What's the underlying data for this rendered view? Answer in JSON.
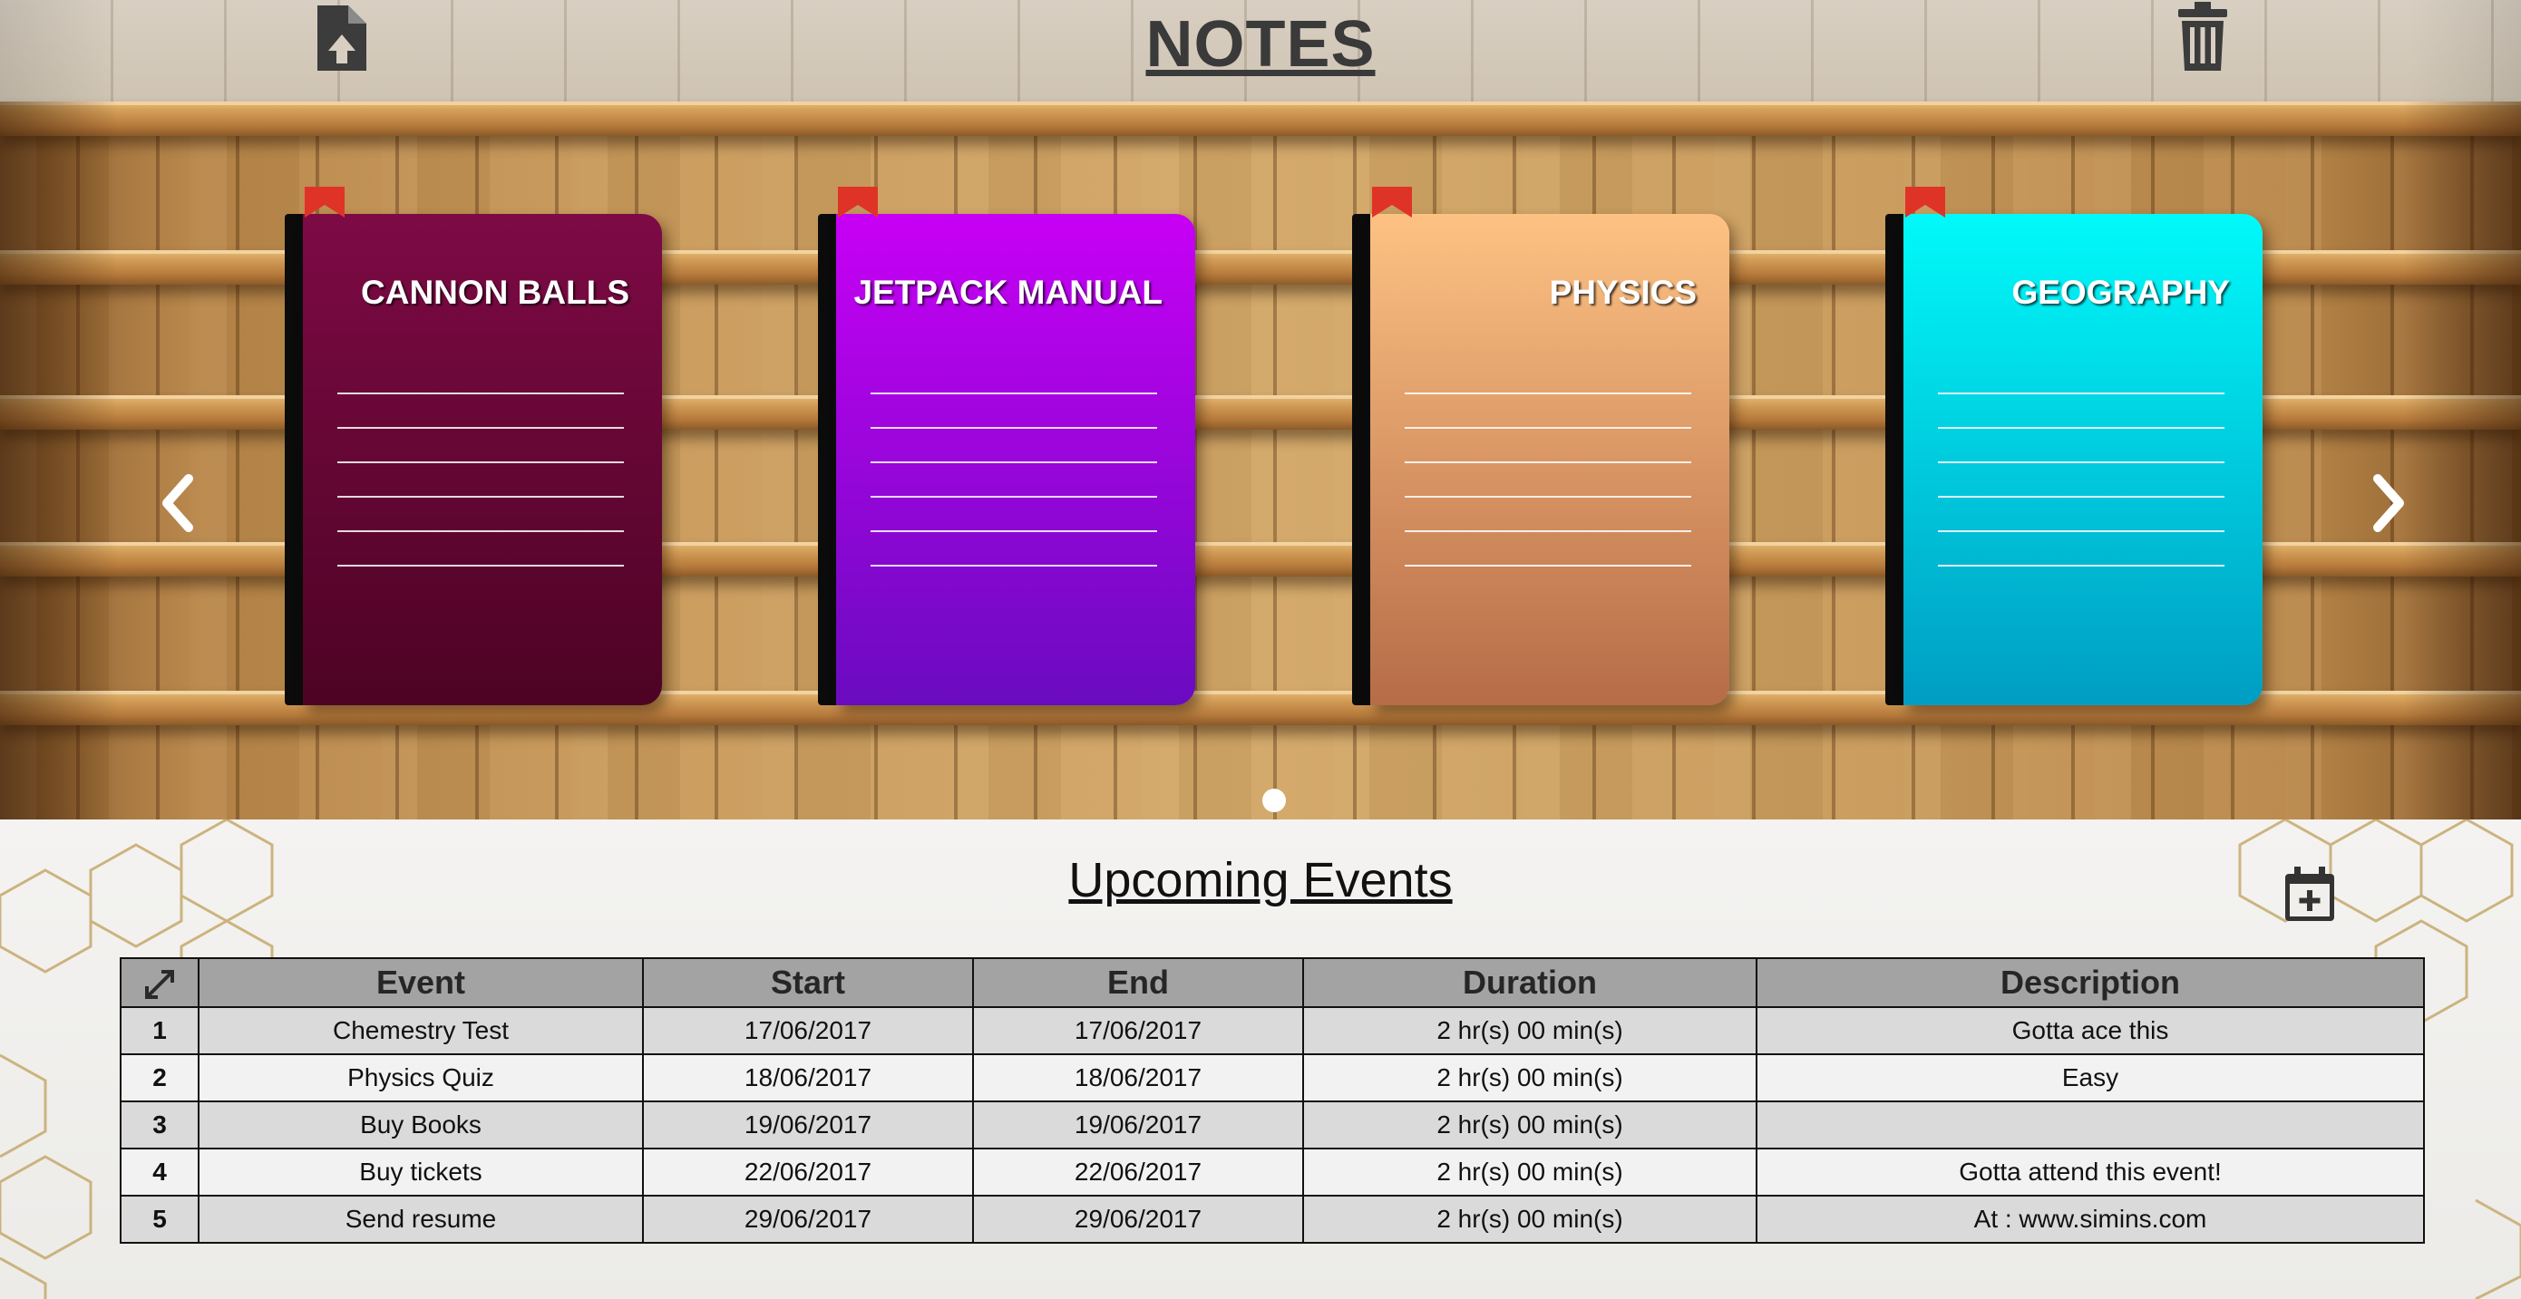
{
  "header": {
    "title": "NOTES",
    "upload_icon": "upload-note-icon",
    "delete_icon": "trash-icon"
  },
  "carousel": {
    "prev_icon": "chevron-left-icon",
    "next_icon": "chevron-right-icon",
    "notebooks": [
      {
        "title": "CANNON BALLS",
        "color_top": "#7d0a45",
        "color_bottom": "#4d0324"
      },
      {
        "title": "JETPACK MANUAL",
        "color_top": "#c800f5",
        "color_bottom": "#6a0bc0"
      },
      {
        "title": "PHYSICS",
        "color_top": "#fdc283",
        "color_bottom": "#b66c47"
      },
      {
        "title": "GEOGRAPHY",
        "color_top": "#00fafa",
        "color_bottom": "#009dc2"
      }
    ],
    "ribbon_color": "#e03327",
    "page_indicator": "1"
  },
  "events": {
    "title": "Upcoming Events",
    "add_icon": "calendar-add-icon",
    "expand_icon": "expand-icon",
    "columns": [
      "Event",
      "Start",
      "End",
      "Duration",
      "Description"
    ],
    "rows": [
      {
        "num": "1",
        "event": "Chemestry Test",
        "start": "17/06/2017",
        "end": "17/06/2017",
        "duration": "2 hr(s) 00 min(s)",
        "description": "Gotta ace this"
      },
      {
        "num": "2",
        "event": "Physics Quiz",
        "start": "18/06/2017",
        "end": "18/06/2017",
        "duration": "2 hr(s) 00 min(s)",
        "description": "Easy"
      },
      {
        "num": "3",
        "event": "Buy Books",
        "start": "19/06/2017",
        "end": "19/06/2017",
        "duration": "2 hr(s) 00 min(s)",
        "description": ""
      },
      {
        "num": "4",
        "event": "Buy tickets",
        "start": "22/06/2017",
        "end": "22/06/2017",
        "duration": "2 hr(s) 00 min(s)",
        "description": "Gotta attend this event!"
      },
      {
        "num": "5",
        "event": "Send resume",
        "start": "29/06/2017",
        "end": "29/06/2017",
        "duration": "2 hr(s) 00 min(s)",
        "description": "At : www.simins.com"
      }
    ]
  }
}
